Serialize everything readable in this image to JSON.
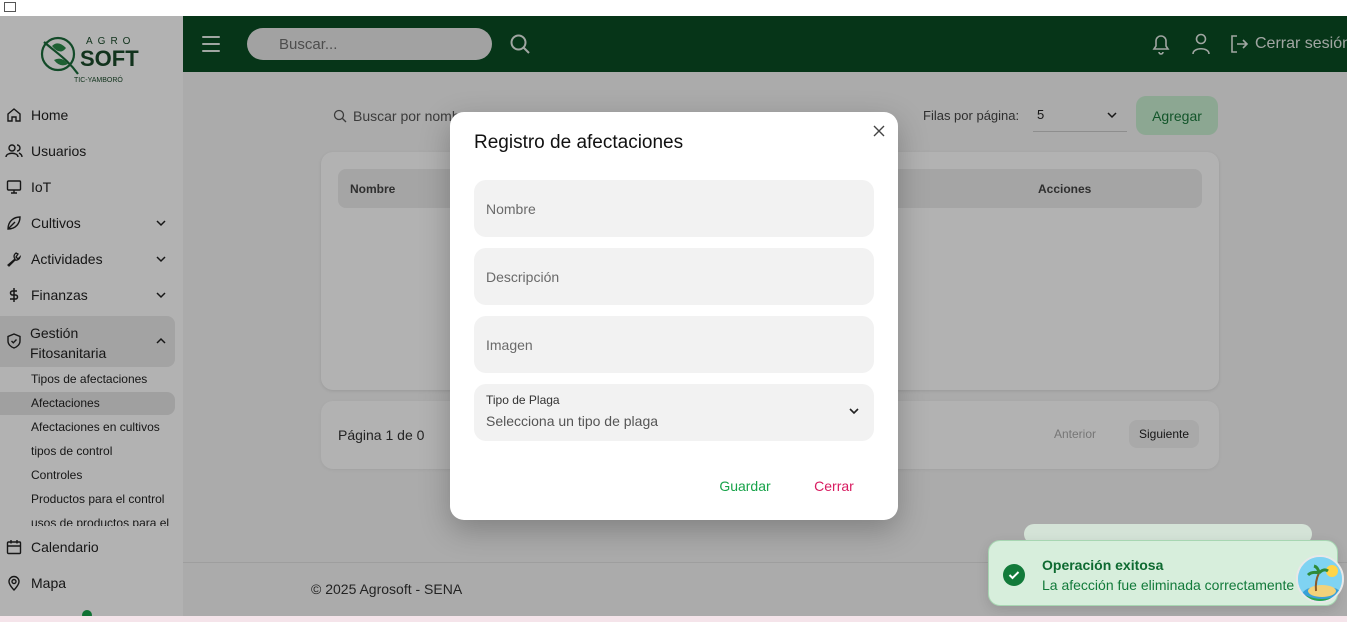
{
  "sidebar": {
    "logo": {
      "line1": "AGRO",
      "line2": "SOFT",
      "line3": "TIC-YAMBORÓ"
    },
    "items": [
      {
        "label": "Home",
        "icon": "home-icon"
      },
      {
        "label": "Usuarios",
        "icon": "users-icon"
      },
      {
        "label": "IoT",
        "icon": "monitor-icon"
      },
      {
        "label": "Cultivos",
        "icon": "leaf-icon"
      },
      {
        "label": "Actividades",
        "icon": "wrench-icon"
      },
      {
        "label": "Finanzas",
        "icon": "dollar-icon"
      }
    ],
    "group": {
      "label": "Gestión Fitosanitaria",
      "icon": "shield-check-icon",
      "subitems": [
        "Tipos de afectaciones",
        "Afectaciones",
        "Afectaciones en cultivos",
        "tipos de control",
        "Controles",
        "Productos para el control",
        "usos de productos para el"
      ]
    },
    "bottom_items": [
      {
        "label": "Calendario",
        "icon": "calendar-icon"
      },
      {
        "label": "Mapa",
        "icon": "map-pin-icon"
      }
    ]
  },
  "header": {
    "search_placeholder": "Buscar...",
    "logout_label": "Cerrar sesión"
  },
  "main": {
    "search_placeholder": "Buscar por nombre...",
    "rows_label": "Filas por página:",
    "rows_value": "5",
    "add_label": "Agregar",
    "table_headers": [
      "Nombre",
      "Acciones"
    ],
    "page_info": "Página 1 de 0",
    "prev_label": "Anterior",
    "next_label": "Siguiente",
    "footer": "© 2025 Agrosoft - SENA"
  },
  "modal": {
    "title": "Registro de afectaciones",
    "fields": {
      "nombre": "Nombre",
      "descripcion": "Descripción",
      "imagen": "Imagen"
    },
    "select_label": "Tipo de Plaga",
    "select_placeholder": "Selecciona un tipo de plaga",
    "save_label": "Guardar",
    "close_label": "Cerrar"
  },
  "toast": {
    "title": "Operación exitosa",
    "message": "La afección fue eliminada correctamente"
  },
  "colors": {
    "header_bg": "#0a4c23",
    "accent_green": "#18a34a",
    "close_pink": "#d81b60"
  }
}
